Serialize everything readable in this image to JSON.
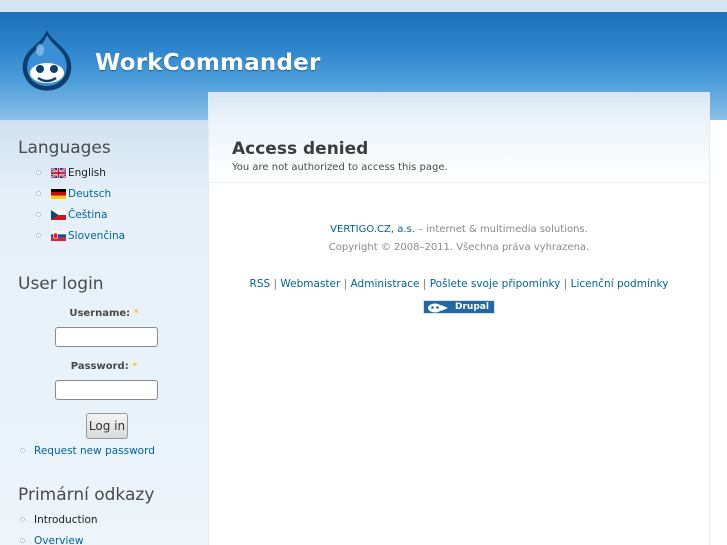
{
  "header": {
    "site_name": "WorkCommander",
    "logo_icon": "drupal-drop-icon"
  },
  "sidebar": {
    "languages": {
      "title": "Languages",
      "items": [
        {
          "label": "English",
          "flag": "uk-flag-icon",
          "active": true
        },
        {
          "label": "Deutsch",
          "flag": "german-flag-icon",
          "active": false
        },
        {
          "label": "Čeština",
          "flag": "czech-flag-icon",
          "active": false
        },
        {
          "label": "Slovenčina",
          "flag": "slovak-flag-icon",
          "active": false
        }
      ]
    },
    "user_login": {
      "title": "User login",
      "username_label": "Username:",
      "password_label": "Password:",
      "required_marker": "*",
      "username_value": "",
      "password_value": "",
      "login_button": "Log in",
      "request_password": "Request new password"
    },
    "primary_links": {
      "title": "Primární odkazy",
      "items": [
        {
          "label": "Introduction",
          "active": true
        },
        {
          "label": "Overview",
          "active": false
        }
      ]
    }
  },
  "main": {
    "title": "Access denied",
    "message": "You are not authorized to access this page."
  },
  "footer": {
    "company_link": "VERTIGO.CZ, a.s.",
    "company_tagline": " – internet & multimedia solutions.",
    "copyright": "Copyright © 2008–2011. Všechna práva vyhrazena.",
    "links": [
      "RSS",
      "Webmaster",
      "Administrace",
      "Pošlete svoje připomínky",
      "Licenční podmínky"
    ],
    "separator": " | ",
    "badge_text": "Drupal"
  },
  "colors": {
    "header_blue": "#2f86cc",
    "link": "#0062a0",
    "sidebar_bg": "#e6f0f8"
  }
}
